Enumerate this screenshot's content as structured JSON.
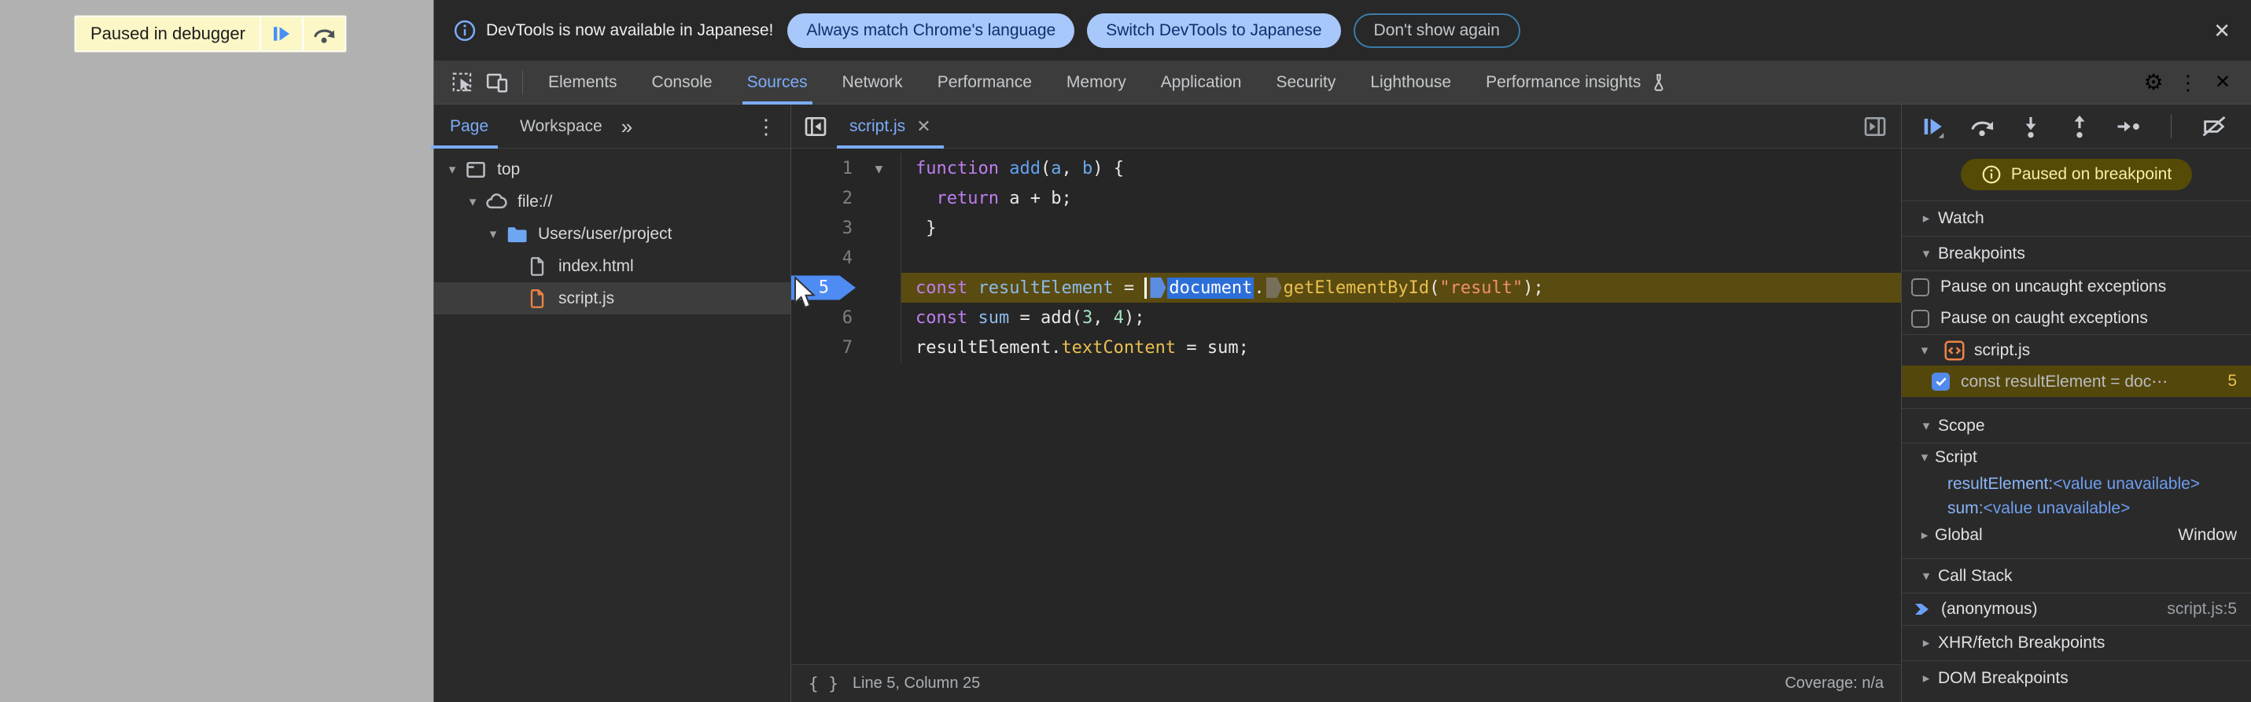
{
  "colors": {
    "accent_blue": "#7cacf8",
    "infobar_pill_bg": "#a8c7fa",
    "paused_banner_bg": "#554a06",
    "paused_banner_text": "#f6efa6",
    "execution_line_bg": "#5a4b10",
    "page_overlay_gray": "#b1b1b1",
    "toast_bg": "#fbf7c6",
    "selection_blue": "#2d6fd9",
    "orange_file": "#ee8445",
    "blue_folder": "#6ea6f2"
  },
  "icons": {
    "close": "✕",
    "gear": "⚙",
    "kebab": "⋮",
    "chevrons": "»",
    "caret_down": "▾",
    "caret_right": "▸",
    "braces": "{ }",
    "fold": "▼"
  },
  "page": {
    "paused_toast": {
      "label": "Paused in debugger"
    }
  },
  "infobar": {
    "message": "DevTools is now available in Japanese!",
    "primary_button": "Always match Chrome's language",
    "secondary_button": "Switch DevTools to Japanese",
    "dismiss_button": "Don't show again"
  },
  "tabs": {
    "active": "Sources",
    "items": [
      "Elements",
      "Console",
      "Sources",
      "Network",
      "Performance",
      "Memory",
      "Application",
      "Security",
      "Lighthouse",
      "Performance insights"
    ]
  },
  "navigator": {
    "tabs": [
      "Page",
      "Workspace"
    ],
    "active_tab": "Page",
    "tree": [
      {
        "label": "top"
      },
      {
        "label": "file://"
      },
      {
        "label": "Users/user/project"
      },
      {
        "label": "index.html"
      },
      {
        "label": "script.js"
      }
    ]
  },
  "editor": {
    "file_tab": "script.js",
    "line_numbers": [
      "1",
      "2",
      "3",
      "4",
      "5",
      "6",
      "7"
    ],
    "code": {
      "l1": {
        "kw": "function",
        "sp": " ",
        "fn": "add",
        "p1": "(",
        "a": "a",
        "c": ", ",
        "b": "b",
        "p2": ") {"
      },
      "l2": {
        "ind": "  ",
        "kw": "return",
        "rest": " a + b;"
      },
      "l3": {
        "t": " }"
      },
      "l4": {
        "t": ""
      },
      "l5": {
        "kw": "const",
        "sp": " ",
        "vr": "resultElement",
        "eq": " = ",
        "sel": "document",
        "dot": ".",
        "prop": "getElementById",
        "po": "(",
        "str": "\"result\"",
        "pc": ");"
      },
      "l6": {
        "kw": "const",
        "sp": " ",
        "vr": "sum",
        "eq": " = add(",
        "n1": "3",
        "c": ", ",
        "n2": "4",
        "pc": ");"
      },
      "l7": {
        "obj": "resultElement.",
        "prop": "textContent",
        "rest": " = sum;"
      }
    },
    "status": {
      "line_col": "Line 5, Column 25",
      "coverage": "Coverage: n/a"
    }
  },
  "debugger": {
    "paused_banner": "Paused on breakpoint",
    "watch_title": "Watch",
    "breakpoints": {
      "title": "Breakpoints",
      "uncaught_label": "Pause on uncaught exceptions",
      "caught_label": "Pause on caught exceptions",
      "group_file": "script.js",
      "entry": {
        "snippet": "const resultElement = doc⋯",
        "line": "5"
      }
    },
    "scope": {
      "title": "Scope",
      "script_section": "Script",
      "vars": [
        {
          "name": "resultElement",
          "sep": ": ",
          "value": "<value unavailable>"
        },
        {
          "name": "sum",
          "sep": ": ",
          "value": "<value unavailable>"
        }
      ],
      "global_section": "Global",
      "global_value": "Window"
    },
    "call_stack": {
      "title": "Call Stack",
      "frames": [
        {
          "name": "(anonymous)",
          "location": "script.js:5"
        }
      ]
    },
    "xhr_title": "XHR/fetch Breakpoints",
    "dom_title": "DOM Breakpoints"
  }
}
